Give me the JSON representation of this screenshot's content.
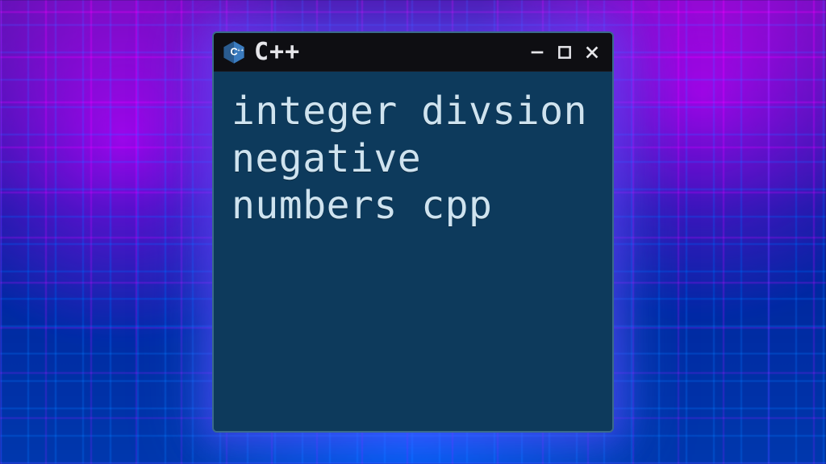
{
  "titlebar": {
    "icon_name": "cpp-logo-icon",
    "title": "C++",
    "controls": {
      "minimize_icon": "minimize-icon",
      "maximize_icon": "maximize-icon",
      "close_icon": "close-icon"
    }
  },
  "body": {
    "content": "integer divsion negative numbers cpp"
  }
}
